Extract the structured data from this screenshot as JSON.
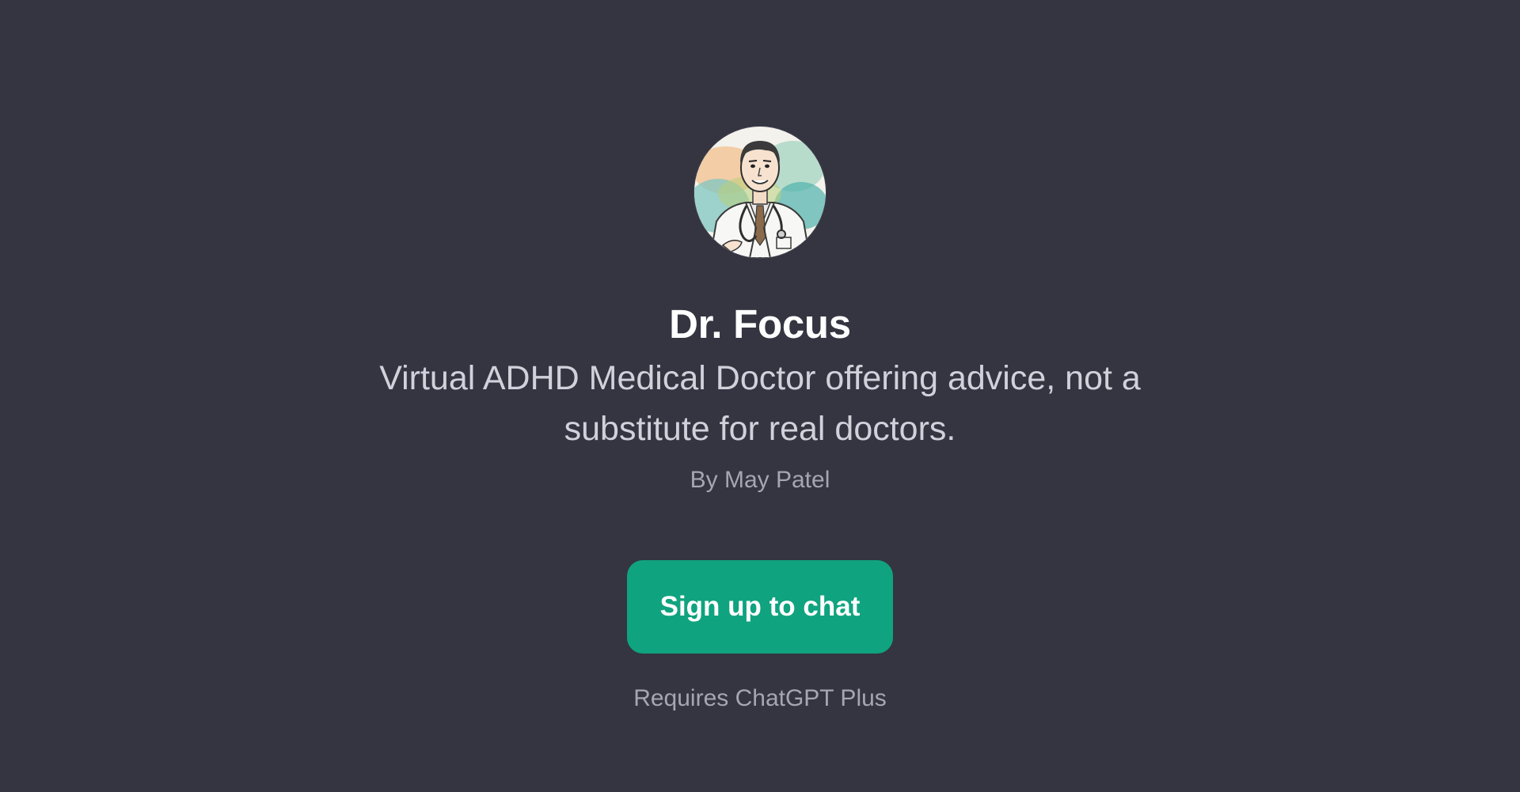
{
  "gpt": {
    "avatar_icon": "doctor-portrait-icon",
    "name": "Dr. Focus",
    "description": "Virtual ADHD Medical Doctor offering advice, not a substitute for real doctors.",
    "author": "By May Patel"
  },
  "cta": {
    "signup_label": "Sign up to chat",
    "requirement": "Requires ChatGPT Plus"
  },
  "colors": {
    "background": "#343541",
    "accent": "#10a37f",
    "title_text": "#ffffff",
    "body_text": "#d1d1da",
    "muted_text": "#a6a6b2"
  }
}
